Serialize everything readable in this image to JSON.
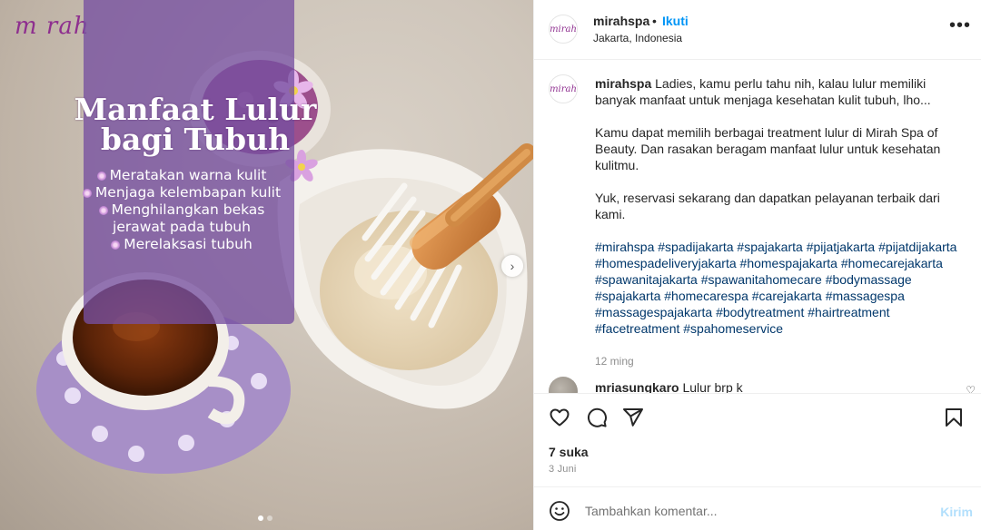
{
  "post_image": {
    "logo_text": "m rah",
    "headline_line1": "Manfaat Lulur",
    "headline_line2": "bagi Tubuh",
    "benefits": [
      "Meratakan warna kulit",
      "Menjaga kelembapan kulit",
      "Menghilangkan bekas",
      "jerawat pada tubuh",
      "Merelaksasi tubuh"
    ],
    "next_glyph": "›",
    "pager_count": 2,
    "pager_active": 0
  },
  "header": {
    "avatar_text": "mirah",
    "username": "mirahspa",
    "separator": "•",
    "follow_label": "Ikuti",
    "location": "Jakarta, Indonesia",
    "more_glyph": "•••"
  },
  "caption": {
    "avatar_text": "mirah",
    "username": "mirahspa",
    "para1": "Ladies, kamu perlu tahu nih, kalau lulur memiliki banyak manfaat untuk menjaga kesehatan kulit tubuh, lho...",
    "para2": "Kamu dapat memilih berbagai treatment lulur di Mirah Spa of Beauty. Dan rasakan beragam manfaat lulur untuk kesehatan kulitmu.",
    "para3": "Yuk, reservasi sekarang dan dapatkan pelayanan terbaik dari kami.",
    "hashtags": "#mirahspa #spadijakarta #spajakarta #pijatjakarta #pijatdijakarta #homespadeliveryjakarta #homespajakarta #homecarejakarta #spawanitajakarta #spawanitahomecare #bodymassage #spajakarta #homecarespa #carejakarta #massagespa #massagespajakarta #bodytreatment #hairtreatment #facetreatment #spahomeservice",
    "time": "12 ming"
  },
  "comment": {
    "username": "mriasungkaro",
    "text": "Lulur brp k",
    "heart_glyph": "♡"
  },
  "actions": {
    "likes": "7 suka",
    "date": "3 Juni"
  },
  "add_comment": {
    "placeholder": "Tambahkan komentar...",
    "post_label": "Kirim"
  }
}
